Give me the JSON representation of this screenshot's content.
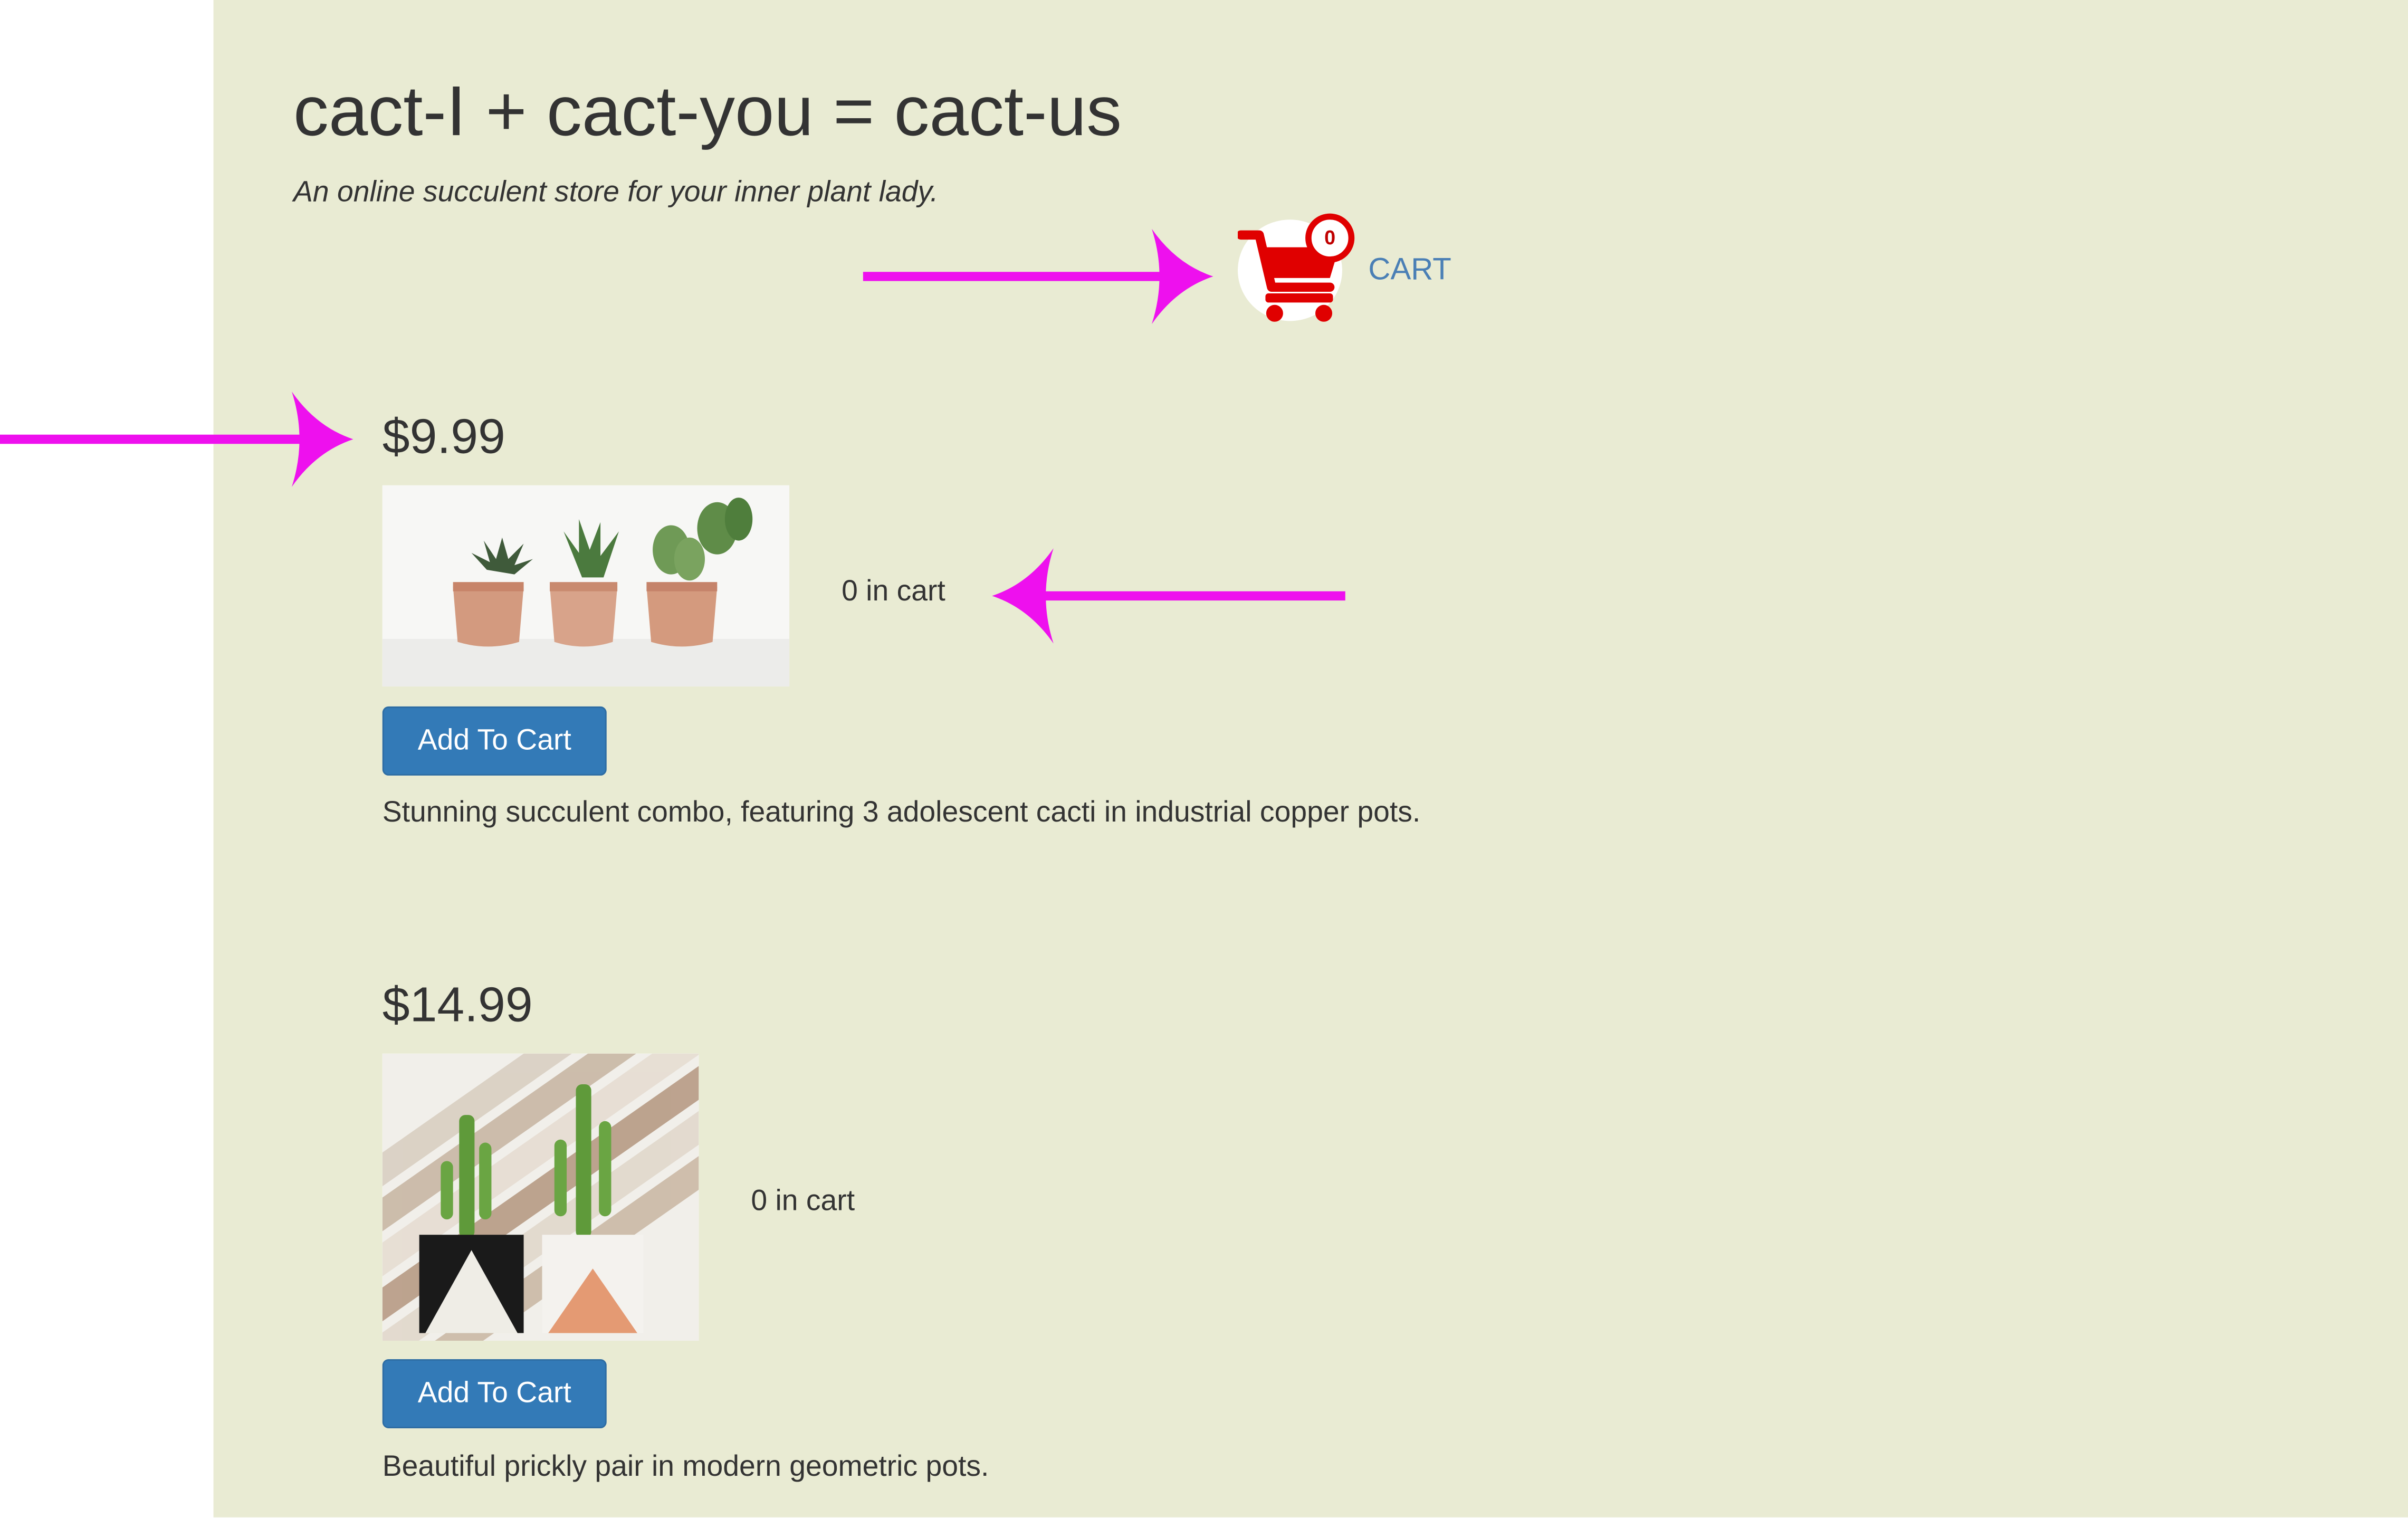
{
  "header": {
    "title": "cact-I + cact-you = cact-us",
    "tagline": "An online succulent store for your inner plant lady."
  },
  "cart": {
    "count": "0",
    "label": "CART",
    "icon": "shopping-cart-icon"
  },
  "products": [
    {
      "price": "$9.99",
      "in_cart": "0 in cart",
      "button_label": "Add To Cart",
      "description": "Stunning succulent combo, featuring 3 adolescent cacti in industrial copper pots."
    },
    {
      "price": "$14.99",
      "in_cart": "0 in cart",
      "button_label": "Add To Cart",
      "description": "Beautiful prickly pair in modern geometric pots."
    }
  ],
  "colors": {
    "page_background": "#e9ebd3",
    "button": "#337ab7",
    "cart_icon": "#e00000",
    "cart_link": "#4a7fb5",
    "annotation_arrow": "#ee10ee"
  }
}
